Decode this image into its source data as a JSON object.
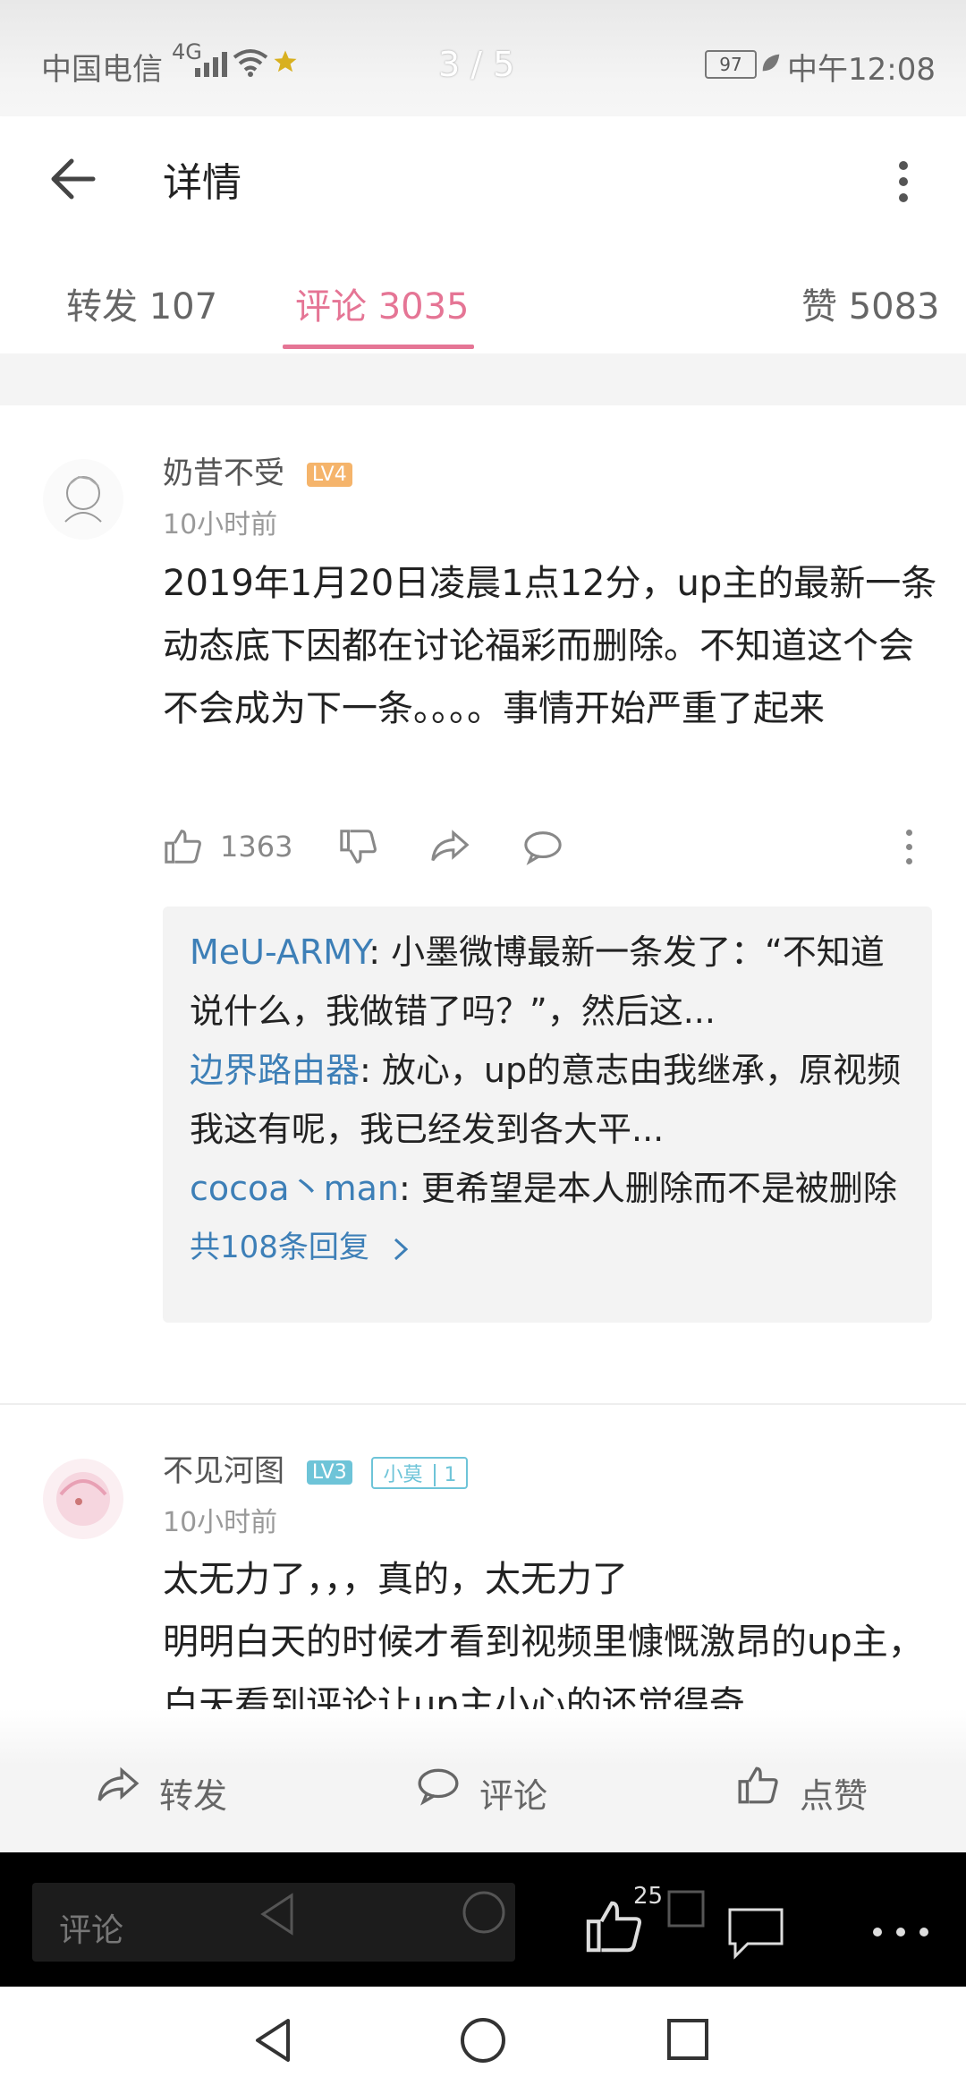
{
  "status_bar": {
    "carrier": "中国电信",
    "network": "4G",
    "pager": "3 / 5",
    "battery": "97",
    "time": "中午12:08"
  },
  "header": {
    "title": "详情"
  },
  "tabs": [
    {
      "label": "转发 107"
    },
    {
      "label": "评论 3035"
    },
    {
      "label": "赞 5083"
    }
  ],
  "comments": [
    {
      "username": "奶昔不受",
      "level": "LV4",
      "time": "10小时前",
      "content": "2019年1月20日凌晨1点12分，up主的最新一条动态底下因都在讨论福彩而删除。不知道这个会不会成为下一条。。。。事情开始严重了起来",
      "likes": "1363",
      "replies": [
        {
          "name": "MeU-ARMY",
          "text": ": 小墨微博最新一条发了：“不知道说什么，我做错了吗？”，然后这..."
        },
        {
          "name": "边界路由器",
          "text": ": 放心，up的意志由我继承，原视频我这有呢，我已经发到各大平..."
        },
        {
          "name": "cocoa丶man",
          "text": ": 更希望是本人删除而不是被删除"
        }
      ],
      "more_replies": "共108条回复"
    },
    {
      "username": "不见河图",
      "level": "LV3",
      "fan_badge": "小莫",
      "fan_level": "1",
      "time": "10小时前",
      "content_line1": "太无力了，，，真的，太无力了",
      "content_line2": "明明白天的时候才看到视频里慷慨激昂的up主，白天看到评论让up主小心的还觉得奇"
    }
  ],
  "bottom_bar": {
    "forward": "转发",
    "comment": "评论",
    "like": "点赞"
  },
  "overlay": {
    "placeholder": "评论",
    "like_count": "25"
  },
  "colors": {
    "accent": "#e57595",
    "link": "#3d7fb7",
    "lv4": "#f5b46b",
    "lv3": "#6ec4d8"
  }
}
